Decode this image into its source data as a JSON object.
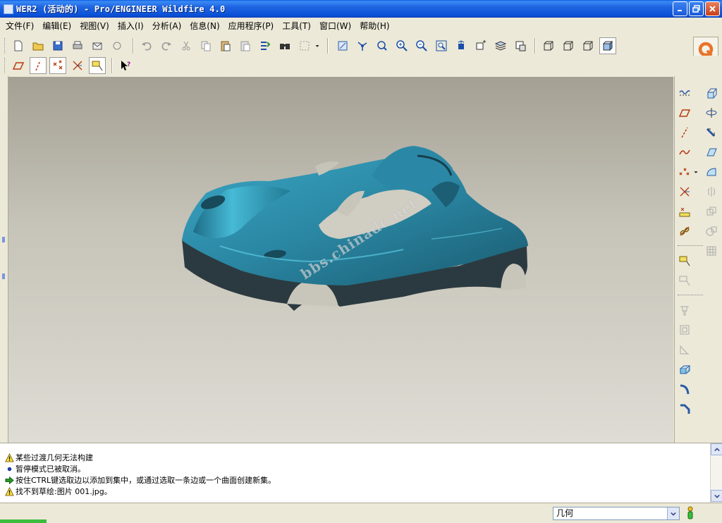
{
  "window": {
    "title": "WER2 (活动的) - Pro/ENGINEER Wildfire 4.0"
  },
  "menu": {
    "items": [
      "文件(F)",
      "编辑(E)",
      "视图(V)",
      "插入(I)",
      "分析(A)",
      "信息(N)",
      "应用程序(P)",
      "工具(T)",
      "窗口(W)",
      "帮助(H)"
    ]
  },
  "viewport": {
    "watermark": "bbs.chinadc.net",
    "background_top": "#a4a094",
    "background_bottom": "#dedcd4",
    "model_color": "#2a8aa6"
  },
  "messages": [
    {
      "icon": "warning-icon",
      "text": "某些过渡几何无法构建"
    },
    {
      "icon": "info-dot-icon",
      "text": "暂停模式已被取消。"
    },
    {
      "icon": "prompt-arrow-icon",
      "text": "按住CTRL键选取边以添加到集中，或通过选取一条边或一个曲面创建新集。"
    },
    {
      "icon": "warning-icon",
      "text": "找不到草绘:图片 001.jpg。"
    }
  ],
  "status": {
    "filter_value": "几何"
  },
  "colors": {
    "title_bar": "#0a50d8",
    "chrome": "#ece9d8",
    "status_green": "#3cbc3c"
  }
}
